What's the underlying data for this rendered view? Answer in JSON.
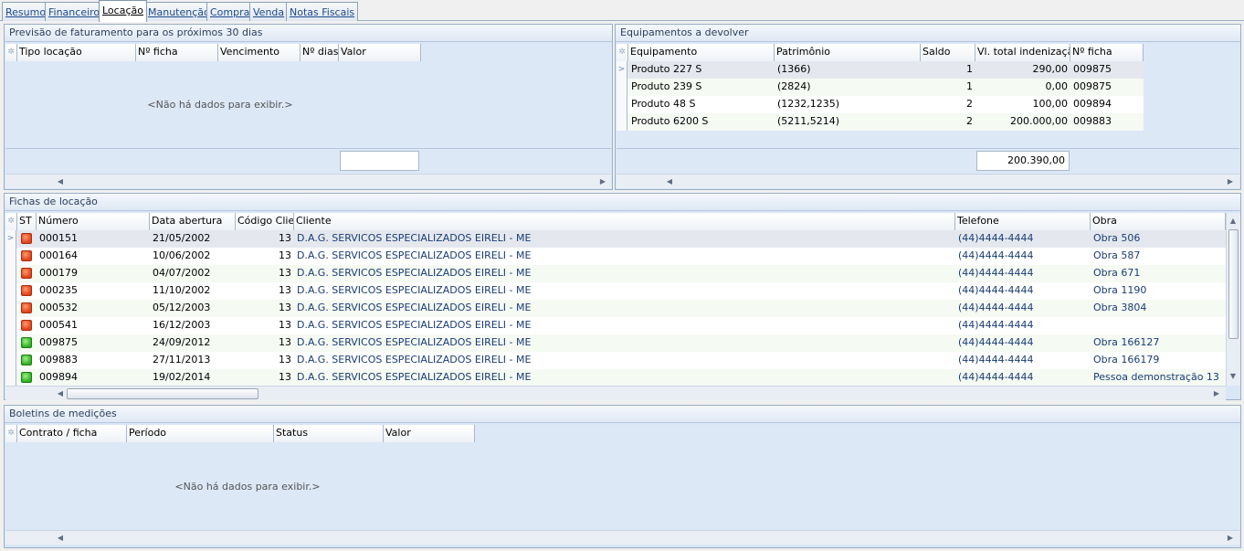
{
  "tabs": [
    {
      "label": "Resumo"
    },
    {
      "label": "Financeiro"
    },
    {
      "label": "Locação",
      "active": true
    },
    {
      "label": "Manutenção"
    },
    {
      "label": "Compra"
    },
    {
      "label": "Venda"
    },
    {
      "label": "Notas Fiscais"
    }
  ],
  "previsao": {
    "title": "Previsão de faturamento para os próximos 30 dias",
    "columns": [
      "Tipo locação",
      "Nº ficha",
      "Vencimento",
      "Nº dias",
      "Valor"
    ],
    "empty_text": "<Não há dados para exibir.>"
  },
  "equipamentos": {
    "title": "Equipamentos a devolver",
    "columns": [
      "Equipamento",
      "Patrimônio",
      "Saldo",
      "Vl. total indenização",
      "Nº ficha"
    ],
    "rows": [
      {
        "equipamento": "Produto 227 S",
        "patrimonio": "(1366)",
        "saldo": "1",
        "valor": "290,00",
        "ficha": "009875"
      },
      {
        "equipamento": "Produto 239 S",
        "patrimonio": "(2824)",
        "saldo": "1",
        "valor": "0,00",
        "ficha": "009875"
      },
      {
        "equipamento": "Produto 48 S",
        "patrimonio": "(1232,1235)",
        "saldo": "2",
        "valor": "100,00",
        "ficha": "009894"
      },
      {
        "equipamento": "Produto 6200 S",
        "patrimonio": "(5211,5214)",
        "saldo": "2",
        "valor": "200.000,00",
        "ficha": "009883"
      }
    ],
    "total": "200.390,00"
  },
  "fichas": {
    "title": "Fichas de locação",
    "columns": [
      "ST",
      "Número",
      "Data abertura",
      "Código Clien",
      "Cliente",
      "Telefone",
      "Obra"
    ],
    "rows": [
      {
        "status": "red",
        "numero": "000151",
        "data": "21/05/2002",
        "codigo": "13",
        "cliente": "D.A.G. SERVICOS ESPECIALIZADOS EIRELI  - ME",
        "telefone": "(44)4444-4444",
        "obra": "Obra 506"
      },
      {
        "status": "red",
        "numero": "000164",
        "data": "10/06/2002",
        "codigo": "13",
        "cliente": "D.A.G. SERVICOS ESPECIALIZADOS EIRELI  - ME",
        "telefone": "(44)4444-4444",
        "obra": "Obra 587"
      },
      {
        "status": "red",
        "numero": "000179",
        "data": "04/07/2002",
        "codigo": "13",
        "cliente": "D.A.G. SERVICOS ESPECIALIZADOS EIRELI  - ME",
        "telefone": "(44)4444-4444",
        "obra": "Obra 671"
      },
      {
        "status": "red",
        "numero": "000235",
        "data": "11/10/2002",
        "codigo": "13",
        "cliente": "D.A.G. SERVICOS ESPECIALIZADOS EIRELI  - ME",
        "telefone": "(44)4444-4444",
        "obra": "Obra 1190"
      },
      {
        "status": "red",
        "numero": "000532",
        "data": "05/12/2003",
        "codigo": "13",
        "cliente": "D.A.G. SERVICOS ESPECIALIZADOS EIRELI  - ME",
        "telefone": "(44)4444-4444",
        "obra": "Obra 3804"
      },
      {
        "status": "red",
        "numero": "000541",
        "data": "16/12/2003",
        "codigo": "13",
        "cliente": "D.A.G. SERVICOS ESPECIALIZADOS EIRELI  - ME",
        "telefone": "(44)4444-4444",
        "obra": ""
      },
      {
        "status": "green",
        "numero": "009875",
        "data": "24/09/2012",
        "codigo": "13",
        "cliente": "D.A.G. SERVICOS ESPECIALIZADOS EIRELI  - ME",
        "telefone": "(44)4444-4444",
        "obra": "Obra 166127"
      },
      {
        "status": "green",
        "numero": "009883",
        "data": "27/11/2013",
        "codigo": "13",
        "cliente": "D.A.G. SERVICOS ESPECIALIZADOS EIRELI  - ME",
        "telefone": "(44)4444-4444",
        "obra": "Obra 166179"
      },
      {
        "status": "green",
        "numero": "009894",
        "data": "19/02/2014",
        "codigo": "13",
        "cliente": "D.A.G. SERVICOS ESPECIALIZADOS EIRELI  - ME",
        "telefone": "(44)4444-4444",
        "obra": "Pessoa demonstração 13"
      }
    ]
  },
  "boletins": {
    "title": "Boletins de medições",
    "columns": [
      "Contrato / ficha",
      "Período",
      "Status",
      "Valor"
    ],
    "empty_text": "<Não há dados para exibir.>"
  },
  "colors": {
    "status_red": "#e0411a",
    "status_green": "#2fb021",
    "panel_bg": "#d9e6f6"
  }
}
